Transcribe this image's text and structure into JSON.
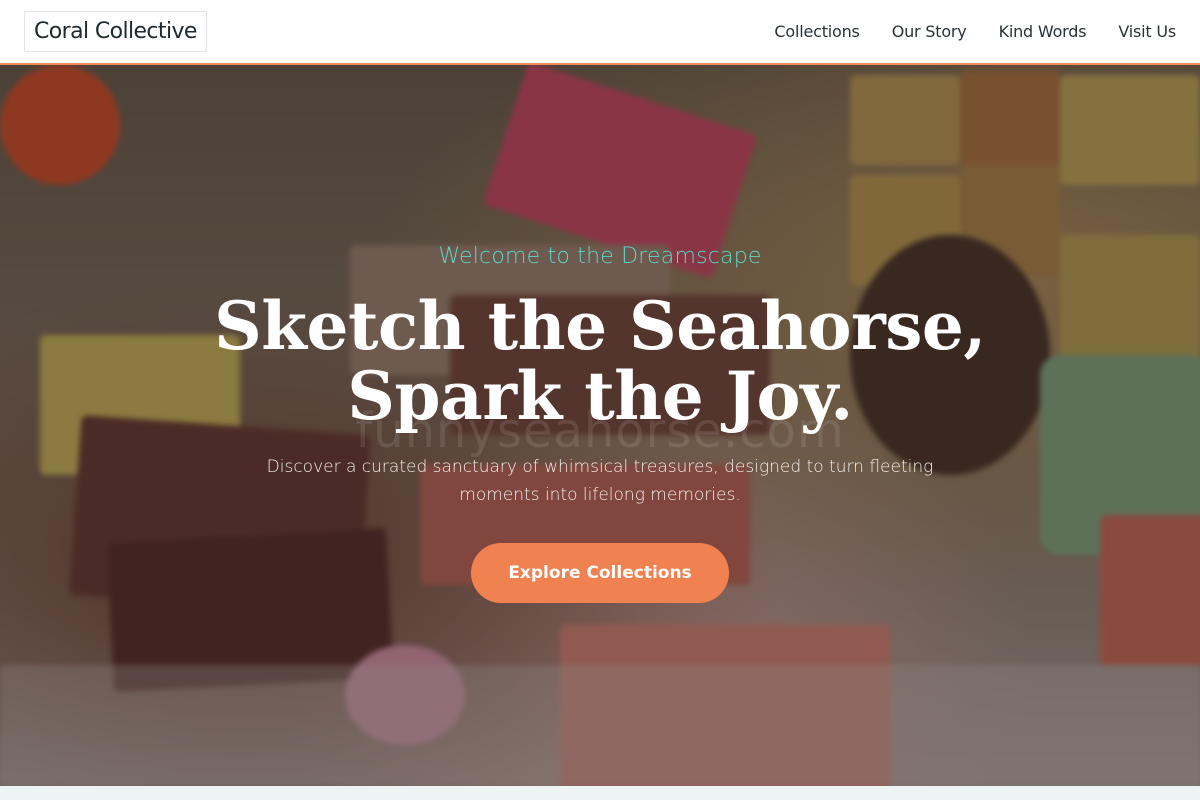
{
  "header": {
    "brand": "Coral Collective",
    "nav": [
      {
        "label": "Collections"
      },
      {
        "label": "Our Story"
      },
      {
        "label": "Kind Words"
      },
      {
        "label": "Visit Us"
      }
    ]
  },
  "hero": {
    "eyebrow": "Welcome to the Dreamscape",
    "headline_line1": "Sketch the Seahorse,",
    "headline_line2": "Spark the Joy.",
    "subtext": "Discover a curated sanctuary of whimsical treasures, designed to turn fleeting moments into lifelong memories.",
    "cta_label": "Explore Collections",
    "watermark": "funnyseahorse.com"
  },
  "colors": {
    "accent": "#f08150",
    "eyebrow": "#5fd6c6",
    "header_border": "#f08a5d"
  }
}
